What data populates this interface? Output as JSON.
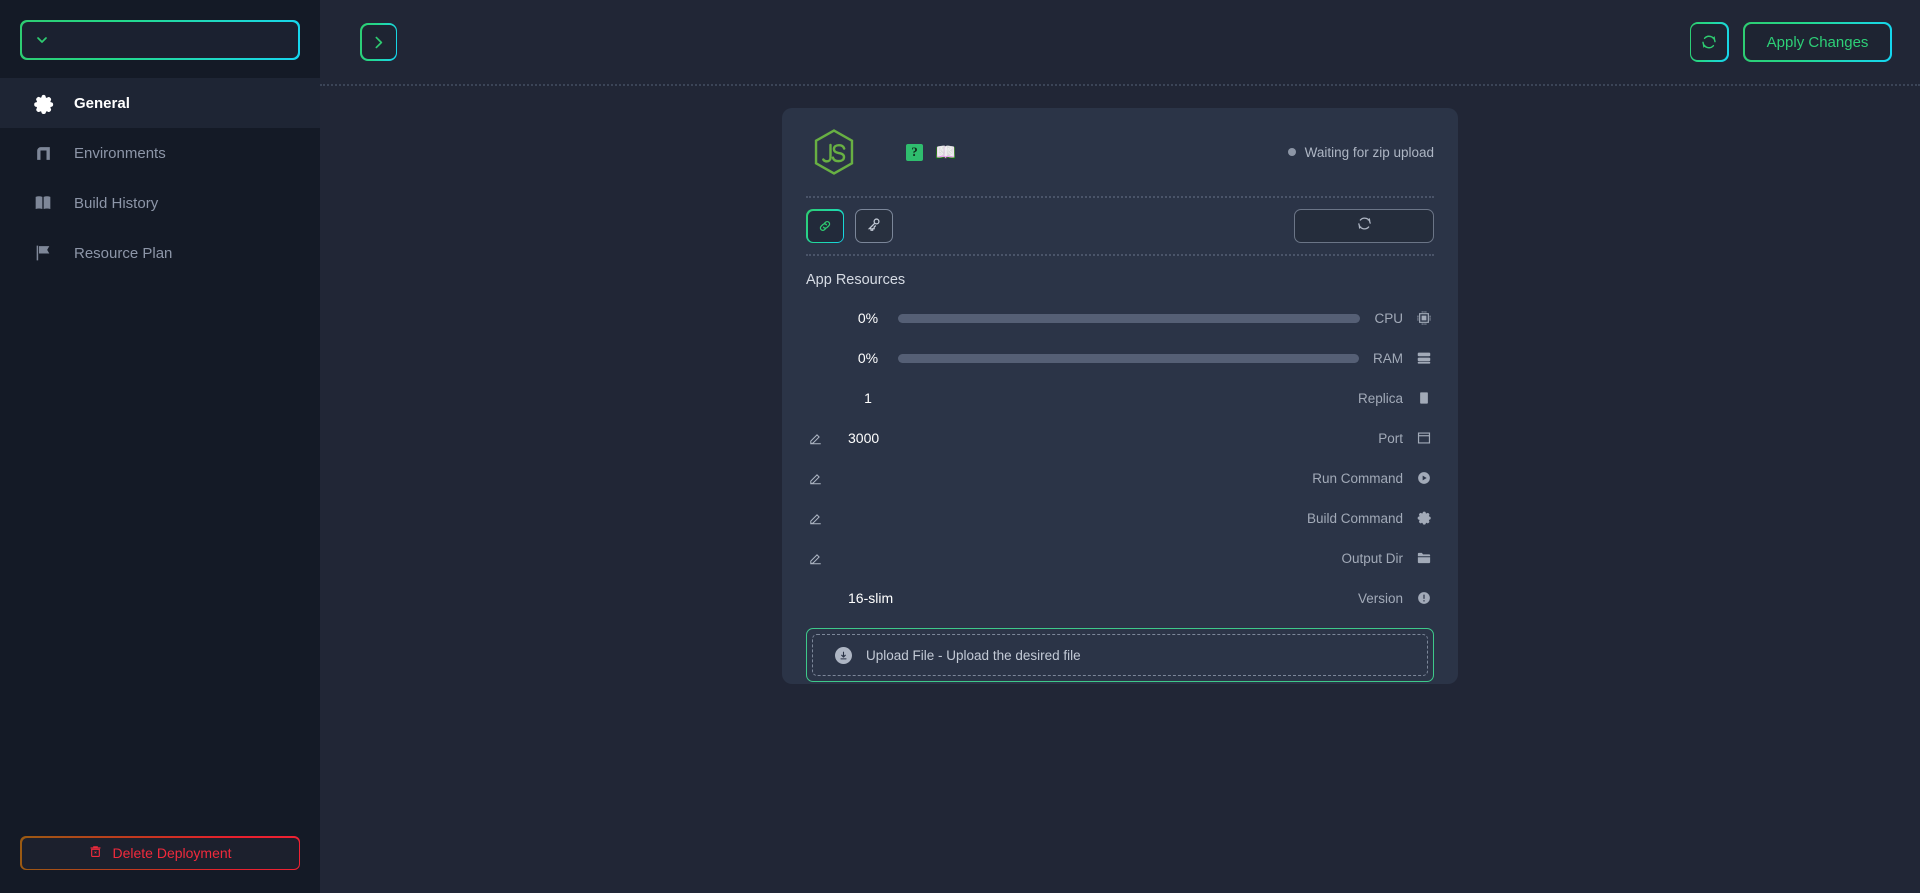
{
  "sidebar": {
    "deployment_select": {
      "value": "",
      "placeholder": ""
    },
    "items": [
      {
        "label": "General",
        "icon": "gear-icon",
        "active": true
      },
      {
        "label": "Environments",
        "icon": "database-icon",
        "active": false
      },
      {
        "label": "Build History",
        "icon": "book-icon",
        "active": false
      },
      {
        "label": "Resource Plan",
        "icon": "flag-icon",
        "active": false
      }
    ],
    "delete_button": {
      "label": "Delete Deployment",
      "icon": "trash-delete-icon"
    }
  },
  "topbar": {
    "collapse_toggle": "chevron-right-icon",
    "refresh_button": "refresh-icon",
    "apply_label": "Apply Changes"
  },
  "card": {
    "runtime_logo": "nodejs-logo",
    "help_badge": "?",
    "docs_icon": "📖",
    "status": {
      "text": "Waiting for zip upload",
      "dot_color": "#8d96a6"
    },
    "tools": [
      {
        "name": "link-icon",
        "active": true
      },
      {
        "name": "key-icon",
        "active": false
      }
    ],
    "sync_button": "sync-icon",
    "section_title": "App Resources",
    "rows": [
      {
        "label": "CPU",
        "value": "0%",
        "icon": "cpu-icon",
        "type": "bar",
        "percent": 0,
        "editable": false
      },
      {
        "label": "RAM",
        "value": "0%",
        "icon": "ram-icon",
        "type": "bar",
        "percent": 0,
        "editable": false
      },
      {
        "label": "Replica",
        "value": "1",
        "icon": "replica-icon",
        "type": "num",
        "editable": false
      },
      {
        "label": "Port",
        "value": "3000",
        "icon": "window-icon",
        "type": "text",
        "editable": true
      },
      {
        "label": "Run Command",
        "value": "",
        "icon": "play-icon",
        "type": "text",
        "editable": true
      },
      {
        "label": "Build Command",
        "value": "",
        "icon": "gear-icon",
        "type": "text",
        "editable": true
      },
      {
        "label": "Output Dir",
        "value": "",
        "icon": "folder-icon",
        "type": "text",
        "editable": true
      },
      {
        "label": "Version",
        "value": "16-slim",
        "icon": "info-icon",
        "type": "text",
        "editable": false
      }
    ],
    "upload": {
      "text": "Upload File - Upload the desired file",
      "icon": "download-circle-icon"
    }
  },
  "colors": {
    "accent_green": "#2ecc71",
    "accent_cyan": "#16d6ef",
    "danger_red": "#f02a3c",
    "sidebar_bg": "#141a26",
    "main_bg": "#212636",
    "card_bg": "#2b3447"
  }
}
